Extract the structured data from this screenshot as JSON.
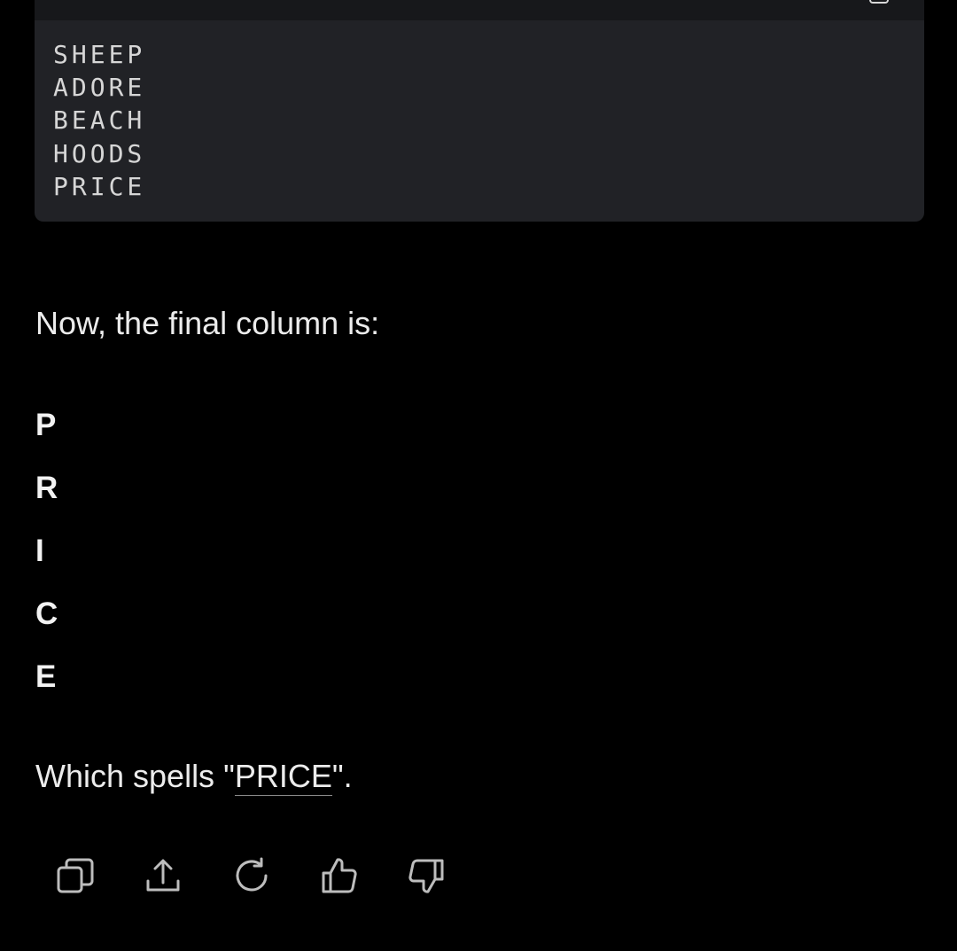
{
  "code_block": {
    "lines": [
      "SHEEP",
      "ADORE",
      "BEACH",
      "HOODS",
      "PRICE"
    ]
  },
  "message": {
    "intro": "Now, the final column is:",
    "column_letters": [
      "P",
      "R",
      "I",
      "C",
      "E"
    ],
    "conclusion_prefix": "Which spells \"",
    "conclusion_word": "PRICE",
    "conclusion_suffix": "\"."
  },
  "actions": [
    {
      "name": "copy-icon"
    },
    {
      "name": "share-icon"
    },
    {
      "name": "regenerate-icon"
    },
    {
      "name": "thumbs-up-icon"
    },
    {
      "name": "thumbs-down-icon"
    }
  ],
  "colors": {
    "background": "#000000",
    "code_background": "#212226",
    "text": "#ececec",
    "icon": "#bdbdbd"
  }
}
